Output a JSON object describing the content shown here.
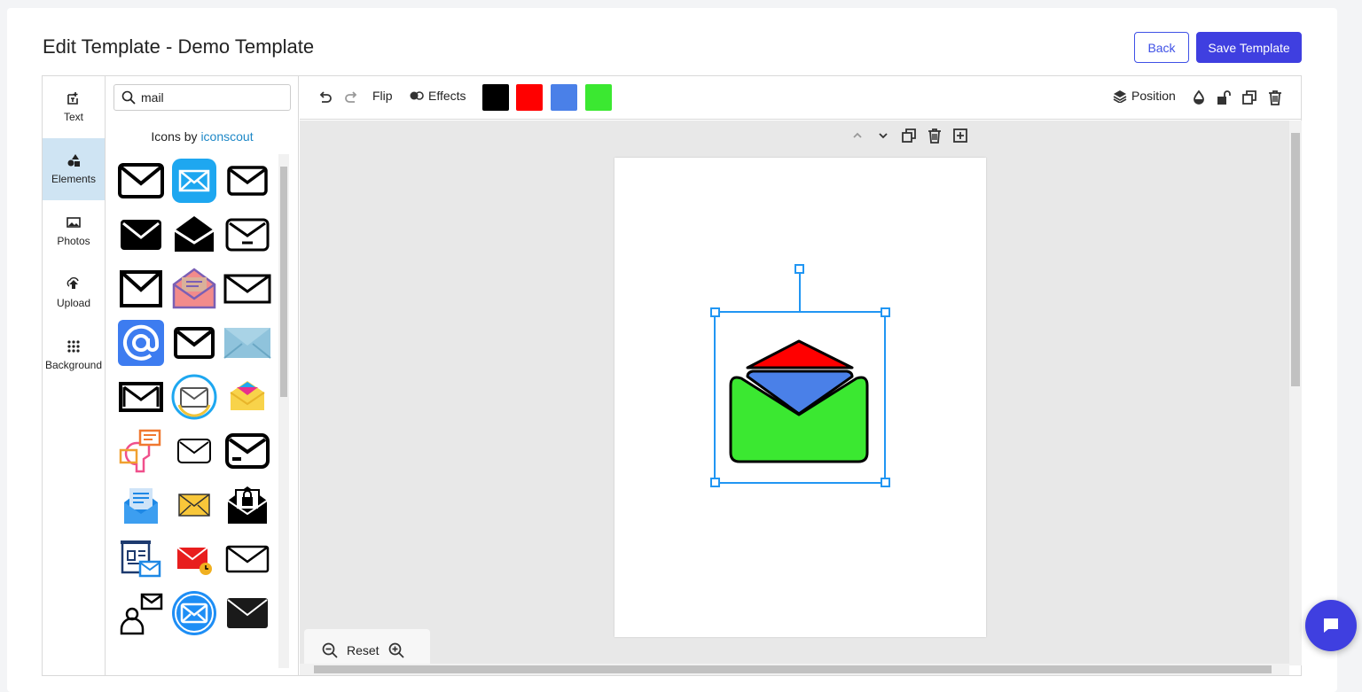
{
  "header": {
    "title": "Edit Template - Demo Template",
    "back_label": "Back",
    "save_label": "Save Template"
  },
  "rail": {
    "items": [
      {
        "label": "Text",
        "icon": "text-add-icon"
      },
      {
        "label": "Elements",
        "icon": "shapes-icon",
        "active": true
      },
      {
        "label": "Photos",
        "icon": "image-icon"
      },
      {
        "label": "Upload",
        "icon": "upload-icon"
      },
      {
        "label": "Background",
        "icon": "grid-dots-icon"
      }
    ]
  },
  "panel": {
    "search_value": "mail",
    "credit_prefix": "Icons by",
    "credit_link": "iconscout",
    "icons": [
      "mail-icon",
      "mail-app-icon",
      "mail-outline-icon",
      "mail-solid-icon",
      "mail-open-icon",
      "mail-minus-icon",
      "mail-icon",
      "mail-open-color-icon",
      "mail-outline-icon",
      "at-sign-icon",
      "mail-icon",
      "mail-flat-icon",
      "mail-icon",
      "mail-circle-icon",
      "mail-open-color-icon",
      "mail-user-icon",
      "mail-outline-icon",
      "mail-card-icon",
      "mail-letter-icon",
      "mail-yellow-icon",
      "mail-lock-icon",
      "mail-document-icon",
      "mail-time-icon",
      "mail-outline-icon",
      "mail-user-icon",
      "mail-circle-icon",
      "mail-solid-icon"
    ]
  },
  "toolbar": {
    "flip_label": "Flip",
    "effects_label": "Effects",
    "swatches": [
      "#000000",
      "#ff0000",
      "#4a80e8",
      "#3be831"
    ],
    "position_label": "Position"
  },
  "canvas": {
    "reset_label": "Reset",
    "element_colors": {
      "flap": "#ff0000",
      "letter": "#4a80e8",
      "body": "#3be831"
    }
  },
  "colors": {
    "accent": "#3f3fe0",
    "selection": "#2196f3",
    "active_rail": "#cfe4f3"
  }
}
